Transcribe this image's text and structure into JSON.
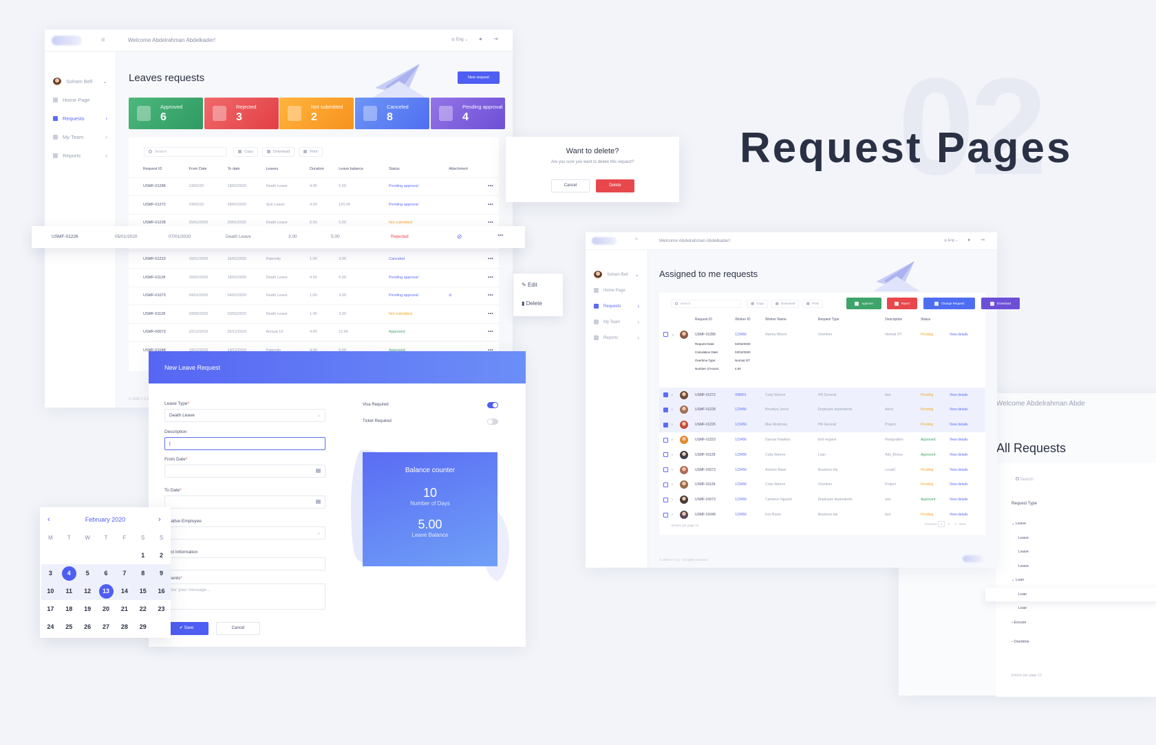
{
  "colors": {
    "primary": "#5b6cf5",
    "approved": "#3fa46a",
    "rejected": "#e8474b",
    "not_submitted": "#f5a623",
    "canceled": "#5b6cf5",
    "pending": "#7c58d8"
  },
  "hero": {
    "number": "02",
    "title": "Request Pages"
  },
  "header": {
    "welcome": "Welcome Abdelrahman Abdelkader!",
    "lang": "Eng"
  },
  "sidebar": {
    "user": "Soham Bell",
    "items": [
      "Home Page",
      "Requests",
      "My Team",
      "Reports"
    ]
  },
  "leaves": {
    "title": "Leaves requests",
    "new_button": "New request",
    "cards": [
      {
        "label": "Approved",
        "count": "6"
      },
      {
        "label": "Rejected",
        "count": "3"
      },
      {
        "label": "Not submitted",
        "count": "2"
      },
      {
        "label": "Canceled",
        "count": "8"
      },
      {
        "label": "Pending approval",
        "count": "4"
      }
    ],
    "toolbar": {
      "search": "Search",
      "copy": "Copy",
      "download": "Download",
      "print": "Print"
    },
    "columns": [
      "Request ID",
      "From Date",
      "To date",
      "Leaves",
      "Duration",
      "Leave balance",
      "Status",
      "Attachment"
    ],
    "rows": [
      [
        "USMF-01288",
        "13/02/20",
        "18/02/2020",
        "Death Leave",
        "4.00",
        "5.00",
        "Pending approval"
      ],
      [
        "USMF-01272",
        "23/02/20",
        "28/02/2020",
        "Sick Leave",
        "4.00",
        "120.00",
        "Pending approval"
      ],
      [
        "USMF-01228",
        "25/01/2020",
        "30/01/2020",
        "Death Leave",
        "6.00",
        "5.00",
        "Not submitted"
      ],
      [
        "USMF-01226",
        "05/01/2020",
        "07/01/2020",
        "Death Leave",
        "3.00",
        "5.00",
        "Rejected"
      ],
      [
        "USMF-01223",
        "16/01/2020",
        "16/01/2020",
        "Paternity",
        "1.00",
        "3.00",
        "Canceled"
      ],
      [
        "USMF-01128",
        "16/02/2020",
        "18/02/2020",
        "Death Leave",
        "4.00",
        "5.00",
        "Pending approval"
      ],
      [
        "USMF-01073",
        "04/01/2020",
        "04/01/2020",
        "Death Leave",
        "1.00",
        "3.00",
        "Pending approval"
      ],
      [
        "USMF-01128",
        "03/05/2020",
        "03/05/2020",
        "Death Leave",
        "1.00",
        "3.00",
        "Not submitted"
      ],
      [
        "USMF-00073",
        "22/12/2019",
        "25/12/2019",
        "Annual 10",
        "4.00",
        "12.66",
        "Approved"
      ],
      [
        "USMF-01048",
        "19/12/2019",
        "19/12/2019",
        "Paternity",
        "4.00",
        "5.00",
        "Approved"
      ]
    ],
    "footer": "© 2020 V 1.0.1"
  },
  "delete_dialog": {
    "title": "Want to delete?",
    "message": "Are you sure you want to delete this request?",
    "cancel": "Cancel",
    "delete": "Delete"
  },
  "context_menu": {
    "edit": "Edit",
    "delete": "Delete"
  },
  "new_leave": {
    "title": "New Leave Request",
    "leave_type_label": "Leave Type",
    "leave_type_value": "Death Leave",
    "description_label": "Description",
    "from_label": "From Date",
    "to_label": "To Date",
    "alt_employee_label": "ernative Employee",
    "contact_label": "ntact Information",
    "comments_label": "mments",
    "comments_placeholder": "nter your message...",
    "visa_label": "Visa Required",
    "ticket_label": "Ticket Required",
    "visa_on": true,
    "ticket_on": false,
    "save": "Save",
    "cancel": "Cancel",
    "balance": {
      "title": "Balance counter",
      "days": "10",
      "days_label": "Number of Days",
      "balance": "5.00",
      "balance_label": "Leave Balance"
    }
  },
  "calendar": {
    "month": "February 2020",
    "weekdays": [
      "M",
      "T",
      "W",
      "T",
      "F",
      "S",
      "S"
    ],
    "weeks": [
      [
        "",
        "",
        "",
        "",
        "",
        "1",
        "2"
      ],
      [
        "3",
        "4",
        "5",
        "6",
        "7",
        "8",
        "9"
      ],
      [
        "10",
        "11",
        "12",
        "13",
        "14",
        "15",
        "16"
      ],
      [
        "17",
        "18",
        "19",
        "20",
        "21",
        "22",
        "23"
      ],
      [
        "24",
        "25",
        "26",
        "27",
        "28",
        "29",
        ""
      ]
    ],
    "selected": [
      "4",
      "13"
    ]
  },
  "assigned": {
    "title": "Assigned to me requests",
    "toolbar": {
      "search": "Search",
      "copy": "Copy",
      "download": "Download",
      "print": "Print"
    },
    "actions": [
      "Approve",
      "Reject",
      "Change Request",
      "Download"
    ],
    "columns": [
      "Request ID",
      "Worker ID",
      "Worker Name",
      "Request Type",
      "Description",
      "Status"
    ],
    "expanded": [
      [
        "Request Date:",
        "02/02/2020"
      ],
      [
        "Calculation Date:",
        "02/02/2020"
      ],
      [
        "Overtime Type:",
        "Normal OT"
      ],
      [
        "Number of Hours:",
        "4.00"
      ]
    ],
    "rows": [
      {
        "id": "USMF-01288",
        "wid": "123456",
        "name": "Norma Wilson",
        "type": "Overtime",
        "desc": "Normal OT",
        "status": "Pending",
        "checked": false,
        "color": "#8a5a44"
      },
      {
        "id": "USMF-01272",
        "wid": "098001",
        "name": "Cody Warren",
        "type": "HR General",
        "desc": "test",
        "status": "Pending",
        "checked": true,
        "color": "#6b4a3a"
      },
      {
        "id": "USMF-01228",
        "wid": "123456",
        "name": "Brooklyn Jones",
        "type": "Employee dependents",
        "desc": "Aerol",
        "status": "Pending",
        "checked": true,
        "color": "#a07058"
      },
      {
        "id": "USMF-01226",
        "wid": "123456",
        "name": "Max Mckinney",
        "type": "HR General",
        "desc": "Project",
        "status": "Pending",
        "checked": true,
        "color": "#c04a3a"
      },
      {
        "id": "USMF-01223",
        "wid": "123456",
        "name": "Darrian Hawkins",
        "type": "Exit request",
        "desc": "Resignation",
        "status": "Approved",
        "checked": false,
        "color": "#e08a2a"
      },
      {
        "id": "USMF-01128",
        "wid": "123456",
        "name": "Cody Warren",
        "type": "Loan",
        "desc": "Adv_Bonus",
        "status": "Approved",
        "checked": false,
        "color": "#3a3a4a"
      },
      {
        "id": "USMF-01073",
        "wid": "123456",
        "name": "Antonio Black",
        "type": "Business trip",
        "desc": "LocalC",
        "status": "Pending",
        "checked": false,
        "color": "#b06a5a"
      },
      {
        "id": "USMF-01128",
        "wid": "123456",
        "name": "Cody Warren",
        "type": "Overtime",
        "desc": "Project",
        "status": "Pending",
        "checked": false,
        "color": "#9a6a4a"
      },
      {
        "id": "USMF-01073",
        "wid": "123456",
        "name": "Cameron Nguyen",
        "type": "Employee dependents",
        "desc": "test",
        "status": "Approved",
        "checked": false,
        "color": "#4a3a3a"
      },
      {
        "id": "USMF-01048",
        "wid": "123456",
        "name": "Kris Burke",
        "type": "Business trip",
        "desc": "test",
        "status": "Pending",
        "checked": false,
        "color": "#5a4a5a"
      }
    ],
    "view": "View details",
    "pagination": {
      "entries": "Entries per page",
      "per": "10",
      "prev": "Previous",
      "pages": [
        "1",
        "2",
        "3"
      ],
      "next": "Next"
    },
    "footer": "© 2020 V 1.0.1 - All rights reserved"
  },
  "all_requests": {
    "welcome": "Welcome Abdelrahman Abde",
    "title": "All Requests",
    "search": "Search",
    "type_label": "Request Type",
    "tree": [
      {
        "label": "Leave",
        "kind": "open"
      },
      {
        "label": "Leave",
        "kind": "child"
      },
      {
        "label": "Leave",
        "kind": "child"
      },
      {
        "label": "Leave",
        "kind": "child"
      },
      {
        "label": "Loan",
        "kind": "open"
      },
      {
        "label": "Loan",
        "kind": "child-active"
      },
      {
        "label": "Loan",
        "kind": "child"
      },
      {
        "label": "Excuse",
        "kind": "closed"
      },
      {
        "label": "Overtime",
        "kind": "closed"
      }
    ],
    "entries": "Entries per page",
    "per": "10"
  }
}
